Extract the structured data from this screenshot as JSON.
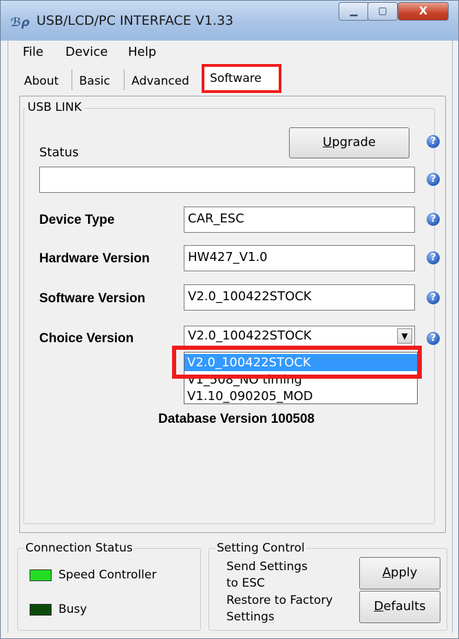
{
  "window": {
    "title": "USB/LCD/PC INTERFACE V1.33",
    "app_icon_glyph": "ℬρ",
    "controls": {
      "minimize": "▁",
      "maximize": "▢",
      "close": "X"
    }
  },
  "menu": {
    "file": "File",
    "device": "Device",
    "help": "Help"
  },
  "tabs": {
    "about": "About",
    "basic": "Basic",
    "advanced": "Advanced",
    "software": "Software",
    "active": "Software"
  },
  "usb_link": {
    "group_label": "USB LINK",
    "upgrade_button": {
      "prefix": "",
      "accel": "U",
      "rest": "pgrade"
    },
    "status_label": "Status",
    "status_value": "",
    "device_type_label": "Device Type",
    "device_type_value": "CAR_ESC",
    "hardware_version_label": "Hardware Version",
    "hardware_version_value": "HW427_V1.0",
    "software_version_label": "Software Version",
    "software_version_value": "V2.0_100422STOCK",
    "choice_version_label": "Choice Version",
    "choice_version_value": "V2.0_100422STOCK",
    "choice_options": [
      "V2.0_100422STOCK",
      "V1_508_NO timing",
      "V1.10_090205_MOD"
    ],
    "database_version": "Database Version 100508",
    "help_glyph": "?"
  },
  "connection_status": {
    "title": "Connection Status",
    "speed_controller_label": "Speed Controller",
    "busy_label": "Busy",
    "colors": {
      "speed_controller": "#22dd22",
      "busy": "#0b4a0b"
    }
  },
  "setting_control": {
    "title": "Setting Control",
    "send_line1": "Send Settings",
    "send_line2": "to ESC",
    "restore_line1": "Restore to Factory",
    "restore_line2": "Settings",
    "apply_button": {
      "accel": "A",
      "rest": "pply"
    },
    "defaults_button": {
      "accel": "D",
      "rest": "efaults"
    }
  },
  "highlight_color": "#ee1c1c",
  "selection_color": "#3399ff"
}
